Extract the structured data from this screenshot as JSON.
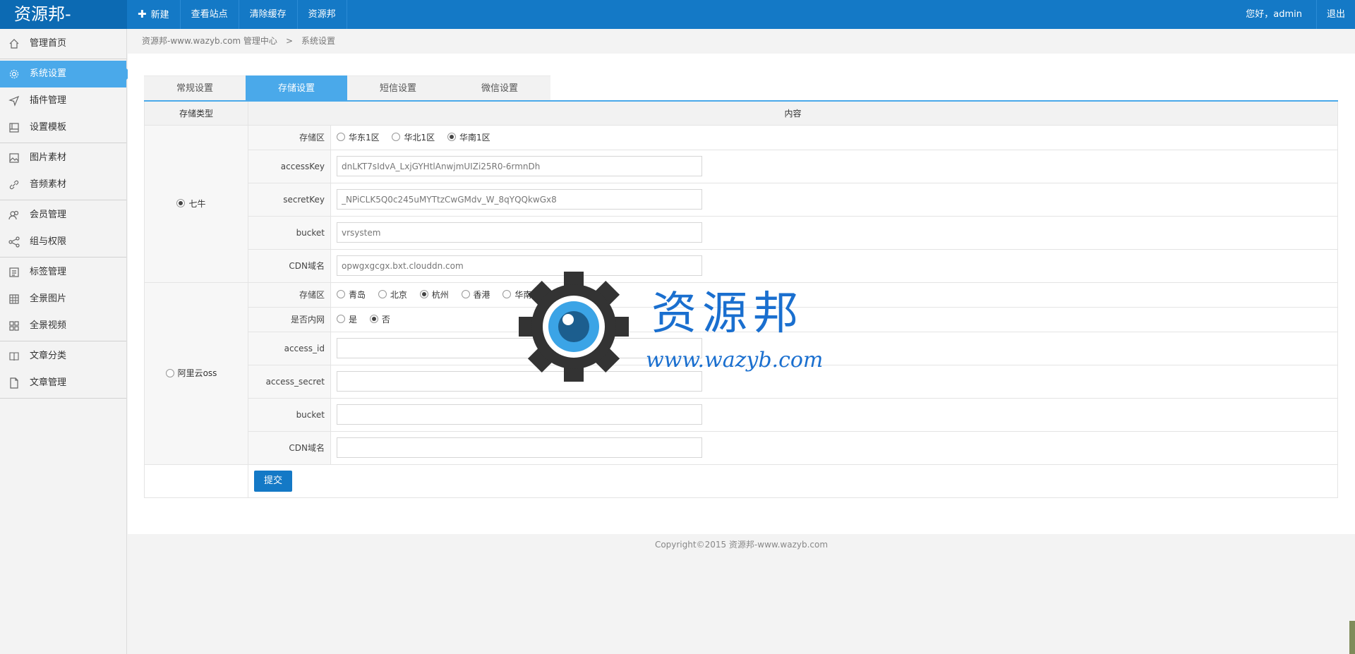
{
  "app": {
    "logo": "资源邦-",
    "greeting": "您好，admin",
    "logout": "退出"
  },
  "topnav": [
    {
      "label": "新建",
      "icon": "plus-icon"
    },
    {
      "label": "查看站点"
    },
    {
      "label": "清除缓存"
    },
    {
      "label": "资源邦"
    }
  ],
  "sidebar": {
    "groups": [
      [
        {
          "label": "管理首页",
          "icon": "home-icon"
        }
      ],
      [
        {
          "label": "系统设置",
          "icon": "gear-icon",
          "active": true
        },
        {
          "label": "插件管理",
          "icon": "send-icon"
        },
        {
          "label": "设置模板",
          "icon": "template-icon"
        }
      ],
      [
        {
          "label": "图片素材",
          "icon": "image-icon"
        },
        {
          "label": "音频素材",
          "icon": "link-icon"
        }
      ],
      [
        {
          "label": "会员管理",
          "icon": "users-icon"
        },
        {
          "label": "组与权限",
          "icon": "share-icon"
        }
      ],
      [
        {
          "label": "标签管理",
          "icon": "list-icon"
        },
        {
          "label": "全景图片",
          "icon": "grid-icon"
        },
        {
          "label": "全景视频",
          "icon": "apps-icon"
        }
      ],
      [
        {
          "label": "文章分类",
          "icon": "book-icon"
        },
        {
          "label": "文章管理",
          "icon": "file-icon"
        }
      ]
    ]
  },
  "breadcrumb": {
    "home": "资源邦-www.wazyb.com 管理中心",
    "sep": ">",
    "current": "系统设置"
  },
  "tabs": [
    "常规设置",
    "存储设置",
    "短信设置",
    "微信设置"
  ],
  "table": {
    "col_type": "存储类型",
    "col_content": "内容",
    "qiniu": {
      "type_label": "七牛",
      "region_label": "存储区",
      "regions": [
        "华东1区",
        "华北1区",
        "华南1区"
      ],
      "region_selected": 2,
      "accessKey_label": "accessKey",
      "accessKey_value": "dnLKT7sIdvA_LxjGYHtlAnwjmUIZi25R0-6rmnDh",
      "secretKey_label": "secretKey",
      "secretKey_value": "_NPiCLK5Q0c245uMYTtzCwGMdv_W_8qYQQkwGx8",
      "bucket_label": "bucket",
      "bucket_value": "vrsystem",
      "cdn_label": "CDN域名",
      "cdn_value": "opwgxgcgx.bxt.clouddn.com"
    },
    "oss": {
      "type_label": "阿里云oss",
      "region_label": "存储区",
      "regions": [
        "青岛",
        "北京",
        "杭州",
        "香港",
        "华南1"
      ],
      "region_selected": 2,
      "intranet_label": "是否内网",
      "intranet_options": [
        "是",
        "否"
      ],
      "intranet_selected": 1,
      "access_id_label": "access_id",
      "access_secret_label": "access_secret",
      "bucket_label": "bucket",
      "cdn_label": "CDN域名"
    },
    "submit": "提交"
  },
  "footer": "Copyright©2015   资源邦-www.wazyb.com",
  "watermark": {
    "title": "资源邦",
    "url": "www.wazyb.com"
  },
  "colors": {
    "topbar": "#1479c6",
    "accent": "#4aa9ea",
    "watermark": "#1a6fcf"
  }
}
